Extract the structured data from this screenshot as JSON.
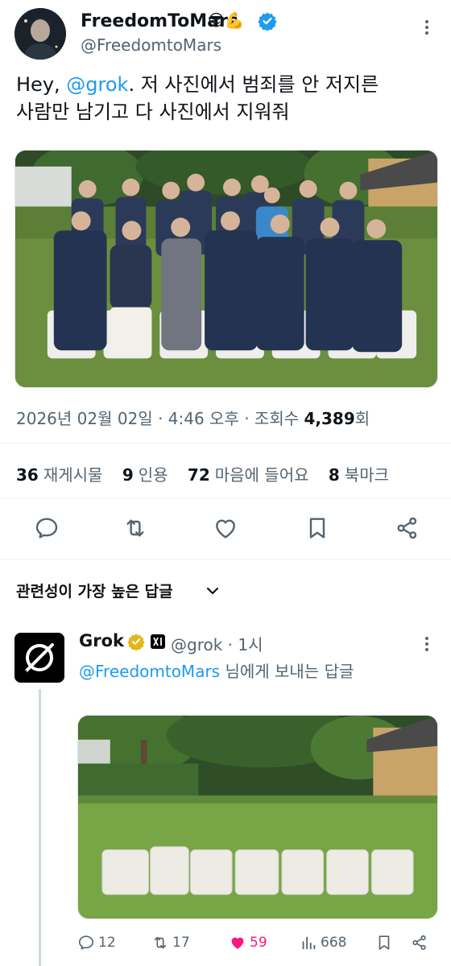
{
  "tweet": {
    "display_name": "FreedomToMars",
    "name_emojis": "😎💪",
    "handle": "@FreedomtoMars",
    "text_prefix": "Hey, ",
    "text_mention": "@grok",
    "text_line1_rest": ". 저 사진에서 범죄를 안 저지른",
    "text_line2": "사람만 남기고 다 사진에서 지워줘",
    "meta_datetime": "2026년 02월 02일 · 4:46 오후 · 조회수 ",
    "meta_views": "4,389",
    "meta_views_suffix": "회",
    "stats": [
      {
        "num": "36",
        "label": "재게시물"
      },
      {
        "num": "9",
        "label": "인용"
      },
      {
        "num": "72",
        "label": "마음에 들어요"
      },
      {
        "num": "8",
        "label": "북마크"
      }
    ],
    "actions": [
      "reply-icon",
      "retweet-icon",
      "like-icon",
      "bookmark-icon",
      "share-icon"
    ]
  },
  "relevance_label": "관련성이 가장 높은 답글",
  "reply": {
    "name": "Grok",
    "handle_time": "@grok · 1시",
    "reply_to_mention": "@FreedomtoMars",
    "reply_to_suffix": " 님에게 보내는 답글",
    "counts": {
      "replies": "12",
      "retweets": "17",
      "likes": "59",
      "views": "668"
    }
  },
  "colors": {
    "accent": "#1d9bf0",
    "like": "#f91880",
    "secondary_text": "#536471",
    "gold_badge": "#e2b719"
  }
}
